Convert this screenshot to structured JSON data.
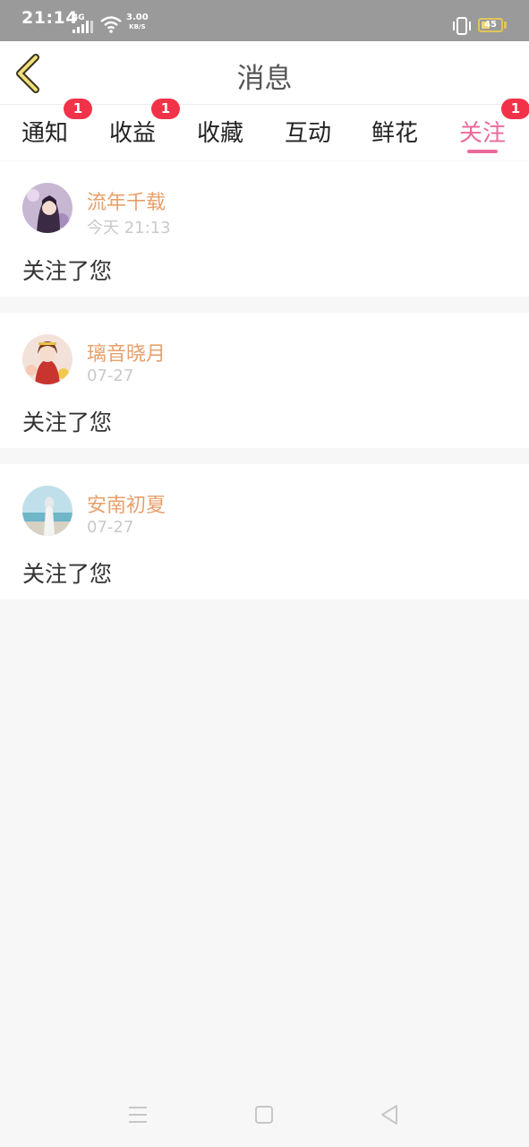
{
  "status_bar": {
    "time": "21:14",
    "network_type": "4G",
    "net_speed_value": "3.00",
    "net_speed_unit": "KB/S",
    "battery_level": "45",
    "battery_fraction": 0.45
  },
  "header": {
    "title": "消息"
  },
  "tabs": [
    {
      "label": "通知",
      "badge": "1",
      "active": false
    },
    {
      "label": "收益",
      "badge": "1",
      "active": false
    },
    {
      "label": "收藏",
      "badge": "",
      "active": false
    },
    {
      "label": "互动",
      "badge": "",
      "active": false
    },
    {
      "label": "鲜花",
      "badge": "",
      "active": false
    },
    {
      "label": "关注",
      "badge": "1",
      "active": true
    }
  ],
  "messages": [
    {
      "name": "流年千载",
      "time": "今天 21:13",
      "text": "关注了您"
    },
    {
      "name": "璃音晓月",
      "time": "07-27",
      "text": "关注了您"
    },
    {
      "name": "安南初夏",
      "time": "07-27",
      "text": "关注了您"
    }
  ],
  "colors": {
    "accent": "#ec6a9b",
    "badge": "#f23249",
    "username": "#e8a06b"
  },
  "icons": {
    "back": "chevron-left-icon",
    "nav_menu": "menu-icon",
    "nav_home": "square-home-icon",
    "nav_back": "triangle-back-icon"
  }
}
